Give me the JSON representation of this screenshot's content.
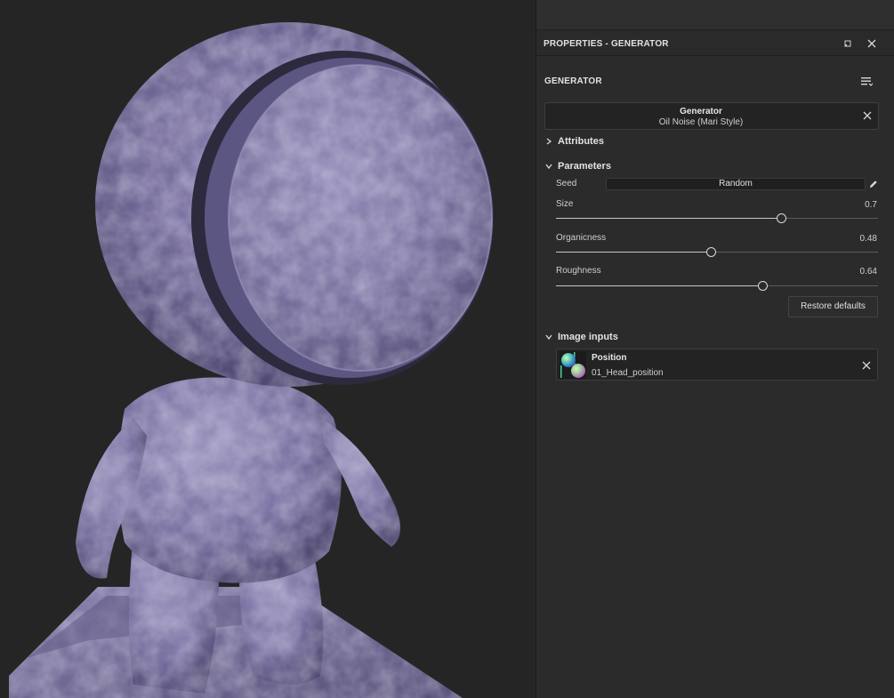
{
  "panel": {
    "title": "PROPERTIES - GENERATOR",
    "section_heading": "GENERATOR"
  },
  "generator": {
    "title": "Generator",
    "name": "Oil Noise (Mari Style)"
  },
  "sections": {
    "attributes": "Attributes",
    "parameters": "Parameters",
    "image_inputs": "Image inputs"
  },
  "params": {
    "seed": {
      "label": "Seed",
      "button": "Random"
    },
    "size": {
      "label": "Size",
      "value": "0.7",
      "fraction": 0.7
    },
    "organicness": {
      "label": "Organicness",
      "value": "0.48",
      "fraction": 0.48
    },
    "roughness": {
      "label": "Roughness",
      "value": "0.64",
      "fraction": 0.64
    }
  },
  "restore_defaults": "Restore defaults",
  "image_input": {
    "title": "Position",
    "value": "01_Head_position"
  },
  "icons": [
    "maximize-icon",
    "close-icon",
    "menu-icon",
    "chevron-right-icon",
    "chevron-down-icon",
    "pencil-icon"
  ],
  "colors": {
    "panel_bg": "#2b2b2b",
    "viewport_bg": "#252525",
    "accent_text": "#e2e2e2"
  }
}
